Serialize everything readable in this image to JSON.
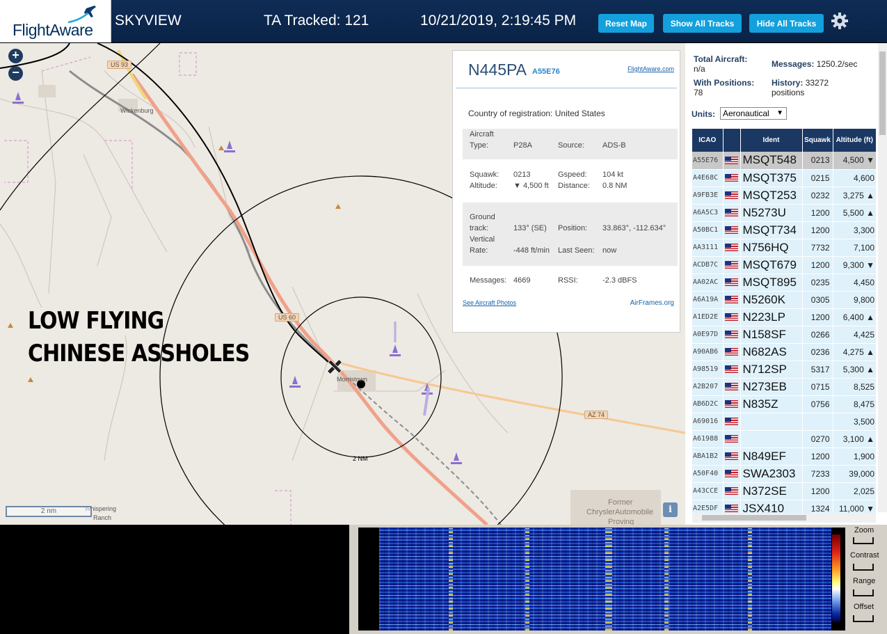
{
  "header": {
    "logo_text": "FlightAware",
    "app_name": "SKYVIEW",
    "ta_tracked": "TA Tracked: 121",
    "datetime": "10/21/2019, 2:19:45 PM",
    "buttons": {
      "reset": "Reset Map",
      "show": "Show All Tracks",
      "hide": "Hide All Tracks"
    },
    "gear_icon": "gear-icon"
  },
  "map": {
    "zoom_in": "+",
    "zoom_out": "−",
    "place_labels": {
      "wickenburg": "Wickenburg",
      "morristown": "Morristown",
      "whispering": "Whispering",
      "ranch": "Ranch",
      "former": "Former",
      "chrysler": "ChryslerAutomobile",
      "proving": "Proving"
    },
    "roads": {
      "us93": "US 93",
      "us60": "US 60",
      "az74": "AZ 74"
    },
    "range_label": "2 NM",
    "scale_label": "2 nm",
    "overlay_line1": "LOW FLYING",
    "overlay_line2": "CHINESE ASSHOLES",
    "info": "i"
  },
  "popup": {
    "ident": "N445PA",
    "hex": "A55E76",
    "link": "FlightAware.com",
    "country_label": "Country of registration:",
    "country": "United States",
    "aircraft_type_label_1": "Aircraft",
    "aircraft_type_label_2": "Type:",
    "aircraft_type": "P28A",
    "source_label": "Source:",
    "source": "ADS-B",
    "squawk_label": "Squawk:",
    "squawk": "0213",
    "gspeed_label": "Gspeed:",
    "gspeed": "104 kt",
    "altitude_label": "Altitude:",
    "altitude": "▼ 4,500 ft",
    "distance_label": "Distance:",
    "distance": "0.8 NM",
    "track_label_1": "Ground",
    "track_label_2": "track:",
    "track": "133° (SE)",
    "position_label": "Position:",
    "position": "33.863°, -112.634°",
    "vrate_label_1": "Vertical",
    "vrate_label_2": "Rate:",
    "vrate": "-448 ft/min",
    "lastseen_label": "Last Seen:",
    "lastseen": "now",
    "messages_label": "Messages:",
    "messages": "4669",
    "rssi_label": "RSSI:",
    "rssi": "-2.3 dBFS",
    "photos": "See Aircraft Photos",
    "airframes": "AirFrames.org"
  },
  "panel": {
    "total_label": "Total Aircraft:",
    "total": "n/a",
    "messages_label": "Messages:",
    "messages": "1250.2/sec",
    "positions_label": "With Positions:",
    "positions": "78",
    "history_label": "History:",
    "history": "33272",
    "history_unit": "positions",
    "units_label": "Units:",
    "units_value": "Aeronautical",
    "columns": [
      "ICAO",
      "",
      "Ident",
      "Squawk",
      "Altitude (ft)"
    ],
    "rows": [
      {
        "icao": "A55E76",
        "ident": "MSQT548",
        "squawk": "0213",
        "alt": "4,500 ▼"
      },
      {
        "icao": "A4E68C",
        "ident": "MSQT375",
        "squawk": "0215",
        "alt": "4,600"
      },
      {
        "icao": "A9FB3E",
        "ident": "MSQT253",
        "squawk": "0232",
        "alt": "3,275 ▲"
      },
      {
        "icao": "A6A5C3",
        "ident": "N5273U",
        "squawk": "1200",
        "alt": "5,500 ▲"
      },
      {
        "icao": "A50BC1",
        "ident": "MSQT734",
        "squawk": "1200",
        "alt": "3,300"
      },
      {
        "icao": "AA3111",
        "ident": "N756HQ",
        "squawk": "7732",
        "alt": "7,100"
      },
      {
        "icao": "ACDB7C",
        "ident": "MSQT679",
        "squawk": "1200",
        "alt": "9,300 ▼"
      },
      {
        "icao": "AA02AC",
        "ident": "MSQT895",
        "squawk": "0235",
        "alt": "4,450"
      },
      {
        "icao": "A6A19A",
        "ident": "N5260K",
        "squawk": "0305",
        "alt": "9,800"
      },
      {
        "icao": "A1ED2E",
        "ident": "N223LP",
        "squawk": "1200",
        "alt": "6,400 ▲"
      },
      {
        "icao": "A0E97D",
        "ident": "N158SF",
        "squawk": "0266",
        "alt": "4,425"
      },
      {
        "icao": "A90AB6",
        "ident": "N682AS",
        "squawk": "0236",
        "alt": "4,275 ▲"
      },
      {
        "icao": "A98519",
        "ident": "N712SP",
        "squawk": "5317",
        "alt": "5,300 ▲"
      },
      {
        "icao": "A2B207",
        "ident": "N273EB",
        "squawk": "0715",
        "alt": "8,525"
      },
      {
        "icao": "AB6D2C",
        "ident": "N835Z",
        "squawk": "0756",
        "alt": "8,475"
      },
      {
        "icao": "A69016",
        "ident": "",
        "squawk": "",
        "alt": "3,500"
      },
      {
        "icao": "A61988",
        "ident": "",
        "squawk": "0270",
        "alt": "3,100 ▲"
      },
      {
        "icao": "ABA1B2",
        "ident": "N849EF",
        "squawk": "1200",
        "alt": "1,900"
      },
      {
        "icao": "A50F40",
        "ident": "SWA2303",
        "squawk": "7233",
        "alt": "39,000"
      },
      {
        "icao": "A43CCE",
        "ident": "N372SE",
        "squawk": "1200",
        "alt": "2,025"
      },
      {
        "icao": "A2E5DF",
        "ident": "JSX410",
        "squawk": "1324",
        "alt": "11,000 ▼"
      }
    ]
  },
  "spectrum": {
    "zoom": "Zoom",
    "contrast": "Contrast",
    "range": "Range",
    "offset": "Offset"
  },
  "colors": {
    "header_bg": "#0a2347",
    "button": "#13a0dc",
    "table_header": "#1b3863",
    "row_bg": "#dff1fa",
    "route": "#f4a08a",
    "plane": "#8a6fd0"
  }
}
